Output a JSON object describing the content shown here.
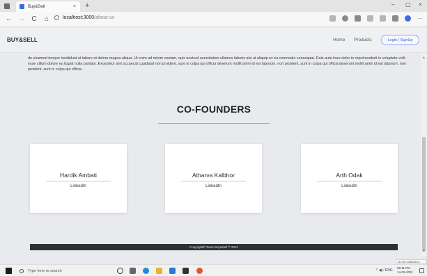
{
  "browser": {
    "tab_title": "Buy&Sell",
    "tab_close": "×",
    "new_tab": "+",
    "window_controls": {
      "minimize": "–",
      "maximize": "▢",
      "close": "×"
    },
    "nav": {
      "back": "←",
      "forward": "→",
      "refresh": "C",
      "home": "⌂"
    },
    "url_host": "localhost:3000",
    "url_path": "/about-us",
    "menu": "···"
  },
  "navbar": {
    "brand": "BUY&SELL",
    "links": [
      "Home",
      "Products"
    ],
    "login_label": "Login | SignUp"
  },
  "content": {
    "paragraph": "do eiusmod tempor incididunt ut labore et dolore magna aliqua. Ut enim ad minim veniam, quis nostrud exercitation ullamco laboris nisi ut aliquip ex ea commodo consequat. Duis aute irure dolor in reprehenderit in voluptate velit esse cillum dolore eu fugiat nulla pariatur. Excepteur sint occaecat cupidatat non proident, sunt in culpa qui officia deserunt mollit anim id est laborum. non proident, sunt in culpa qui officia deserunt mollit anim id est laborum. non proident, sunt in culpa qui officia.",
    "section_title": "CO-FOUNDERS",
    "founders": [
      {
        "name": "Hardik Ambati",
        "link": "LinkedIn"
      },
      {
        "name": "Atharva Kalbhor",
        "link": "LinkedIn"
      },
      {
        "name": "Arth Odak",
        "link": "LinkedIn"
      }
    ],
    "footer": "Copyright® Team Buy&Sell™ 2021"
  },
  "scrollbar": {
    "up": "▲",
    "down": "▼"
  },
  "notification": "No new notifications",
  "taskbar": {
    "search_placeholder": "Type here to search",
    "tray": "^ ◀) ⁄ ENG",
    "time": "09:11 PM",
    "date": "14-05-2021"
  }
}
